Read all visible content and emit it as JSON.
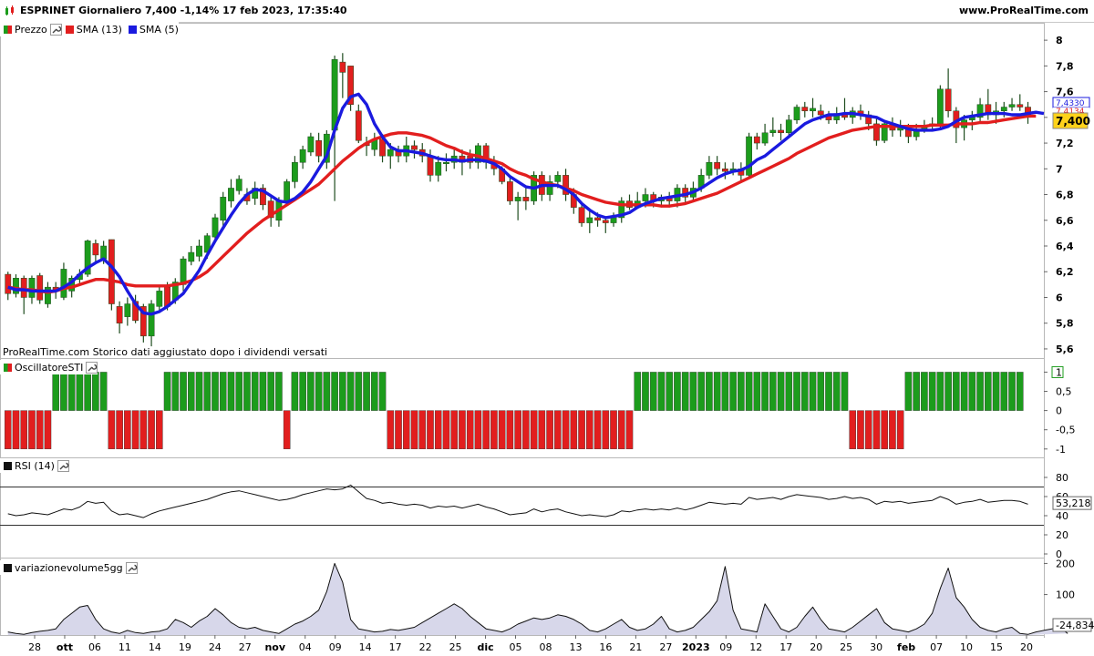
{
  "header": {
    "title": "ESPRINET Giornaliero 7,400 -1,14% 17 feb 2023, 17:35:40",
    "site": "www.ProRealTime.com"
  },
  "legend_price": [
    {
      "label": "Prezzo",
      "color": "split",
      "icon": "candle-icon"
    },
    {
      "label": "SMA (13)",
      "color": "#e21e1e",
      "icon": "line-swatch-icon"
    },
    {
      "label": "SMA (5)",
      "color": "#1a1adf",
      "icon": "line-swatch-icon"
    }
  ],
  "legend_osc": {
    "label": "OscillatoreSTI"
  },
  "legend_rsi": {
    "label": "RSI (14)"
  },
  "legend_vol": {
    "label": "variazionevolume5gg"
  },
  "note": "ProRealTime.com Storico dati aggiustato dopo i dividendi versati",
  "price_axis": {
    "ticks": [
      "8",
      "7,8",
      "7,6",
      "7,4",
      "7,2",
      "7",
      "6,8",
      "6,6",
      "6,4",
      "6,2",
      "6",
      "5,8",
      "5,6"
    ],
    "last_price": "7,400",
    "sma5_tag": "7,4330",
    "sma13_tag": "7,4134"
  },
  "osc_axis": {
    "ticks": [
      "1",
      "0,5",
      "0",
      "-0,5",
      "-1"
    ]
  },
  "rsi_axis": {
    "ticks": [
      "80",
      "60",
      "40",
      "20",
      "0"
    ],
    "value": "53,218"
  },
  "vol_axis": {
    "ticks": [
      "200",
      "100"
    ],
    "value": "-24,834"
  },
  "x_axis": {
    "labels": [
      "28",
      "ott",
      "06",
      "11",
      "14",
      "19",
      "24",
      "27",
      "nov",
      "04",
      "09",
      "14",
      "17",
      "22",
      "25",
      "dic",
      "05",
      "08",
      "13",
      "16",
      "21",
      "27",
      "2023",
      "09",
      "12",
      "17",
      "20",
      "25",
      "30",
      "feb",
      "07",
      "10",
      "15",
      "20"
    ],
    "bold": [
      "ott",
      "nov",
      "dic",
      "2023",
      "feb"
    ]
  },
  "colors": {
    "up": "#1c9c1c",
    "down": "#e21e1e",
    "sma13": "#e21e1e",
    "sma5": "#1a1adf",
    "wick": "#1f4d1f",
    "vol_fill": "#d7d7ea"
  },
  "chart_data": {
    "type": "candlestick",
    "title": "ESPRINET Giornaliero 7,400 -1,14% 17 feb 2023, 17:35:40",
    "ylim": [
      5.55,
      8.1
    ],
    "candles": [
      [
        6.18,
        6.03,
        6.2,
        5.98
      ],
      [
        6.03,
        6.15,
        6.18,
        6.0
      ],
      [
        6.15,
        6.0,
        6.17,
        5.87
      ],
      [
        6.0,
        6.15,
        6.17,
        5.95
      ],
      [
        6.17,
        5.98,
        6.19,
        5.95
      ],
      [
        5.95,
        6.08,
        6.12,
        5.92
      ],
      [
        6.08,
        6.05,
        6.12,
        5.99
      ],
      [
        6.0,
        6.22,
        6.27,
        5.98
      ],
      [
        6.05,
        6.15,
        6.17,
        6.0
      ],
      [
        6.14,
        6.18,
        6.22,
        6.1
      ],
      [
        6.18,
        6.44,
        6.45,
        6.16
      ],
      [
        6.42,
        6.33,
        6.45,
        6.28
      ],
      [
        6.3,
        6.4,
        6.44,
        6.26
      ],
      [
        6.45,
        5.95,
        6.45,
        5.9
      ],
      [
        5.93,
        5.8,
        5.97,
        5.72
      ],
      [
        5.85,
        5.95,
        6.0,
        5.78
      ],
      [
        5.97,
        5.82,
        6.02,
        5.8
      ],
      [
        5.93,
        5.7,
        5.95,
        5.65
      ],
      [
        5.7,
        5.95,
        5.98,
        5.62
      ],
      [
        5.93,
        6.05,
        6.08,
        5.9
      ],
      [
        6.08,
        5.93,
        6.12,
        5.9
      ],
      [
        5.98,
        6.12,
        6.15,
        5.95
      ],
      [
        6.1,
        6.3,
        6.32,
        6.05
      ],
      [
        6.28,
        6.35,
        6.4,
        6.25
      ],
      [
        6.32,
        6.4,
        6.45,
        6.28
      ],
      [
        6.35,
        6.48,
        6.5,
        6.3
      ],
      [
        6.47,
        6.62,
        6.65,
        6.43
      ],
      [
        6.6,
        6.78,
        6.82,
        6.55
      ],
      [
        6.75,
        6.85,
        6.92,
        6.7
      ],
      [
        6.83,
        6.92,
        6.95,
        6.8
      ],
      [
        6.8,
        6.75,
        6.85,
        6.72
      ],
      [
        6.77,
        6.85,
        6.9,
        6.72
      ],
      [
        6.85,
        6.72,
        6.88,
        6.68
      ],
      [
        6.75,
        6.62,
        6.8,
        6.55
      ],
      [
        6.6,
        6.75,
        6.78,
        6.55
      ],
      [
        6.75,
        6.9,
        6.92,
        6.72
      ],
      [
        6.9,
        7.05,
        7.1,
        6.85
      ],
      [
        7.05,
        7.15,
        7.18,
        7.0
      ],
      [
        7.13,
        7.25,
        7.28,
        7.1
      ],
      [
        7.22,
        7.1,
        7.28,
        7.05
      ],
      [
        7.05,
        7.27,
        7.3,
        7.0
      ],
      [
        7.3,
        7.85,
        7.88,
        6.75
      ],
      [
        7.83,
        7.75,
        7.9,
        7.55
      ],
      [
        7.8,
        7.5,
        7.8,
        7.45
      ],
      [
        7.45,
        7.22,
        7.5,
        7.2
      ],
      [
        7.2,
        7.18,
        7.25,
        7.1
      ],
      [
        7.15,
        7.23,
        7.28,
        7.1
      ],
      [
        7.23,
        7.1,
        7.27,
        7.05
      ],
      [
        7.1,
        7.15,
        7.2,
        7.0
      ],
      [
        7.15,
        7.1,
        7.18,
        7.05
      ],
      [
        7.1,
        7.18,
        7.25,
        7.05
      ],
      [
        7.18,
        7.15,
        7.22,
        7.08
      ],
      [
        7.15,
        7.1,
        7.2,
        7.05
      ],
      [
        7.1,
        6.95,
        7.15,
        6.9
      ],
      [
        6.95,
        7.05,
        7.1,
        6.9
      ],
      [
        7.05,
        7.05,
        7.12,
        6.98
      ],
      [
        7.05,
        7.1,
        7.15,
        7.0
      ],
      [
        7.1,
        7.05,
        7.15,
        6.95
      ],
      [
        7.1,
        7.05,
        7.15,
        7.0
      ],
      [
        7.05,
        7.18,
        7.2,
        7.0
      ],
      [
        7.18,
        7.05,
        7.2,
        7.0
      ],
      [
        7.05,
        7.0,
        7.1,
        6.95
      ],
      [
        7.0,
        6.9,
        7.02,
        6.88
      ],
      [
        6.9,
        6.75,
        6.93,
        6.72
      ],
      [
        6.75,
        6.78,
        6.82,
        6.6
      ],
      [
        6.78,
        6.75,
        6.85,
        6.68
      ],
      [
        6.75,
        6.95,
        6.98,
        6.72
      ],
      [
        6.95,
        6.8,
        6.98,
        6.75
      ],
      [
        6.8,
        6.9,
        6.95,
        6.75
      ],
      [
        6.9,
        6.95,
        6.98,
        6.85
      ],
      [
        6.95,
        6.8,
        7.0,
        6.75
      ],
      [
        6.8,
        6.7,
        6.85,
        6.65
      ],
      [
        6.7,
        6.58,
        6.72,
        6.55
      ],
      [
        6.58,
        6.62,
        6.67,
        6.5
      ],
      [
        6.62,
        6.6,
        6.66,
        6.55
      ],
      [
        6.6,
        6.58,
        6.63,
        6.5
      ],
      [
        6.58,
        6.62,
        6.66,
        6.55
      ],
      [
        6.62,
        6.75,
        6.78,
        6.58
      ],
      [
        6.75,
        6.7,
        6.8,
        6.68
      ],
      [
        6.7,
        6.75,
        6.82,
        6.7
      ],
      [
        6.75,
        6.8,
        6.85,
        6.7
      ],
      [
        6.8,
        6.75,
        6.82,
        6.7
      ],
      [
        6.75,
        6.78,
        6.8,
        6.7
      ],
      [
        6.78,
        6.75,
        6.82,
        6.7
      ],
      [
        6.75,
        6.85,
        6.88,
        6.7
      ],
      [
        6.85,
        6.78,
        6.88,
        6.72
      ],
      [
        6.78,
        6.85,
        6.9,
        6.75
      ],
      [
        6.85,
        6.95,
        7.0,
        6.82
      ],
      [
        6.95,
        7.05,
        7.1,
        6.92
      ],
      [
        7.05,
        7.0,
        7.1,
        6.95
      ],
      [
        7.0,
        6.98,
        7.05,
        6.92
      ],
      [
        6.98,
        7.0,
        7.05,
        6.95
      ],
      [
        7.0,
        6.95,
        7.05,
        6.9
      ],
      [
        6.95,
        7.25,
        7.28,
        6.92
      ],
      [
        7.25,
        7.2,
        7.28,
        7.15
      ],
      [
        7.2,
        7.28,
        7.35,
        7.18
      ],
      [
        7.28,
        7.3,
        7.4,
        7.25
      ],
      [
        7.3,
        7.28,
        7.35,
        7.22
      ],
      [
        7.28,
        7.38,
        7.42,
        7.25
      ],
      [
        7.38,
        7.48,
        7.5,
        7.35
      ],
      [
        7.48,
        7.45,
        7.52,
        7.4
      ],
      [
        7.45,
        7.47,
        7.55,
        7.4
      ],
      [
        7.45,
        7.42,
        7.5,
        7.38
      ],
      [
        7.42,
        7.38,
        7.45,
        7.35
      ],
      [
        7.38,
        7.43,
        7.48,
        7.35
      ],
      [
        7.43,
        7.4,
        7.55,
        7.38
      ],
      [
        7.4,
        7.45,
        7.48,
        7.35
      ],
      [
        7.45,
        7.42,
        7.5,
        7.38
      ],
      [
        7.42,
        7.35,
        7.45,
        7.3
      ],
      [
        7.35,
        7.22,
        7.4,
        7.18
      ],
      [
        7.22,
        7.35,
        7.38,
        7.2
      ],
      [
        7.35,
        7.3,
        7.4,
        7.25
      ],
      [
        7.3,
        7.32,
        7.38,
        7.25
      ],
      [
        7.32,
        7.25,
        7.35,
        7.2
      ],
      [
        7.25,
        7.3,
        7.35,
        7.22
      ],
      [
        7.3,
        7.33,
        7.38,
        7.28
      ],
      [
        7.33,
        7.35,
        7.4,
        7.3
      ],
      [
        7.35,
        7.62,
        7.65,
        7.32
      ],
      [
        7.62,
        7.45,
        7.78,
        7.4
      ],
      [
        7.45,
        7.32,
        7.48,
        7.2
      ],
      [
        7.32,
        7.38,
        7.42,
        7.22
      ],
      [
        7.38,
        7.4,
        7.45,
        7.3
      ],
      [
        7.4,
        7.5,
        7.55,
        7.35
      ],
      [
        7.5,
        7.42,
        7.62,
        7.38
      ],
      [
        7.42,
        7.45,
        7.52,
        7.35
      ],
      [
        7.45,
        7.48,
        7.52,
        7.4
      ],
      [
        7.48,
        7.5,
        7.55,
        7.45
      ],
      [
        7.5,
        7.48,
        7.58,
        7.45
      ],
      [
        7.48,
        7.4,
        7.52,
        7.35
      ]
    ],
    "sma13": [
      6.08,
      6.07,
      6.06,
      6.06,
      6.05,
      6.04,
      6.05,
      6.07,
      6.08,
      6.1,
      6.12,
      6.14,
      6.14,
      6.13,
      6.12,
      6.1,
      6.09,
      6.09,
      6.09,
      6.09,
      6.09,
      6.1,
      6.11,
      6.13,
      6.16,
      6.2,
      6.26,
      6.32,
      6.38,
      6.44,
      6.5,
      6.55,
      6.6,
      6.64,
      6.68,
      6.72,
      6.76,
      6.8,
      6.84,
      6.88,
      6.94,
      7.0,
      7.06,
      7.11,
      7.16,
      7.2,
      7.23,
      7.25,
      7.27,
      7.28,
      7.28,
      7.27,
      7.26,
      7.24,
      7.21,
      7.18,
      7.16,
      7.13,
      7.11,
      7.1,
      7.08,
      7.06,
      7.04,
      7.0,
      6.97,
      6.95,
      6.92,
      6.9,
      6.88,
      6.87,
      6.85,
      6.83,
      6.8,
      6.78,
      6.76,
      6.74,
      6.73,
      6.72,
      6.72,
      6.72,
      6.72,
      6.72,
      6.71,
      6.71,
      6.72,
      6.73,
      6.75,
      6.77,
      6.79,
      6.81,
      6.84,
      6.87,
      6.9,
      6.93,
      6.96,
      6.99,
      7.02,
      7.05,
      7.08,
      7.12,
      7.15,
      7.18,
      7.21,
      7.24,
      7.26,
      7.28,
      7.3,
      7.31,
      7.32,
      7.33,
      7.33,
      7.33,
      7.33,
      7.33,
      7.33,
      7.33,
      7.34,
      7.34,
      7.34,
      7.35,
      7.35,
      7.35,
      7.36,
      7.36,
      7.37,
      7.38,
      7.39,
      7.4,
      7.41,
      7.41
    ],
    "sma5": [
      6.08,
      6.06,
      6.06,
      6.05,
      6.05,
      6.05,
      6.05,
      6.08,
      6.12,
      6.18,
      6.23,
      6.27,
      6.3,
      6.24,
      6.16,
      6.05,
      5.95,
      5.88,
      5.87,
      5.89,
      5.93,
      5.98,
      6.03,
      6.12,
      6.21,
      6.33,
      6.44,
      6.54,
      6.64,
      6.73,
      6.8,
      6.84,
      6.83,
      6.79,
      6.75,
      6.74,
      6.77,
      6.82,
      6.9,
      7.0,
      7.1,
      7.3,
      7.47,
      7.56,
      7.58,
      7.5,
      7.35,
      7.25,
      7.17,
      7.14,
      7.14,
      7.13,
      7.12,
      7.1,
      7.08,
      7.07,
      7.07,
      7.06,
      7.07,
      7.07,
      7.06,
      7.04,
      7.0,
      6.94,
      6.9,
      6.86,
      6.85,
      6.87,
      6.87,
      6.87,
      6.84,
      6.8,
      6.73,
      6.68,
      6.64,
      6.62,
      6.63,
      6.64,
      6.66,
      6.7,
      6.73,
      6.75,
      6.77,
      6.78,
      6.79,
      6.8,
      6.82,
      6.85,
      6.89,
      6.93,
      6.96,
      6.98,
      6.99,
      7.02,
      7.07,
      7.1,
      7.15,
      7.2,
      7.25,
      7.3,
      7.35,
      7.38,
      7.4,
      7.42,
      7.42,
      7.43,
      7.43,
      7.42,
      7.41,
      7.4,
      7.37,
      7.35,
      7.33,
      7.31,
      7.3,
      7.3,
      7.3,
      7.31,
      7.33,
      7.37,
      7.4,
      7.41,
      7.42,
      7.43,
      7.43,
      7.43,
      7.42,
      7.42,
      7.43,
      7.44,
      7.43
    ],
    "oscillator": [
      -1,
      -1,
      -1,
      -1,
      -1,
      -1,
      1,
      1,
      1,
      1,
      1,
      1,
      1,
      -1,
      -1,
      -1,
      -1,
      -1,
      -1,
      -1,
      1,
      1,
      1,
      1,
      1,
      1,
      1,
      1,
      1,
      1,
      1,
      1,
      1,
      1,
      1,
      -1,
      1,
      1,
      1,
      1,
      1,
      1,
      1,
      1,
      1,
      1,
      1,
      1,
      -1,
      -1,
      -1,
      -1,
      -1,
      -1,
      -1,
      -1,
      -1,
      -1,
      -1,
      -1,
      -1,
      -1,
      -1,
      -1,
      -1,
      -1,
      -1,
      -1,
      -1,
      -1,
      -1,
      -1,
      -1,
      -1,
      -1,
      -1,
      -1,
      -1,
      -1,
      1,
      1,
      1,
      1,
      1,
      1,
      1,
      1,
      1,
      1,
      1,
      1,
      1,
      1,
      1,
      1,
      1,
      1,
      1,
      1,
      1,
      1,
      1,
      1,
      1,
      1,
      1,
      -1,
      -1,
      -1,
      -1,
      -1,
      -1,
      -1,
      1,
      1,
      1,
      1,
      1,
      1,
      1,
      1,
      1,
      1,
      1,
      1,
      1,
      1,
      1
    ],
    "rsi": [
      42,
      40,
      41,
      43,
      42,
      41,
      44,
      47,
      46,
      49,
      55,
      53,
      54,
      45,
      41,
      42,
      40,
      38,
      42,
      45,
      47,
      49,
      51,
      53,
      55,
      57,
      60,
      63,
      65,
      66,
      64,
      62,
      60,
      58,
      56,
      57,
      59,
      62,
      64,
      66,
      68,
      67,
      68,
      72,
      65,
      58,
      56,
      53,
      54,
      52,
      51,
      52,
      51,
      48,
      50,
      49,
      50,
      48,
      50,
      52,
      49,
      47,
      44,
      41,
      42,
      43,
      47,
      44,
      46,
      47,
      44,
      42,
      40,
      41,
      40,
      39,
      41,
      45,
      44,
      46,
      47,
      46,
      47,
      46,
      48,
      46,
      48,
      51,
      54,
      53,
      52,
      53,
      52,
      59,
      57,
      58,
      59,
      57,
      60,
      62,
      61,
      60,
      59,
      57,
      58,
      60,
      58,
      59,
      57,
      52,
      55,
      54,
      55,
      53,
      54,
      55,
      56,
      60,
      57,
      52,
      54,
      55,
      57,
      54,
      55,
      56,
      56,
      55,
      52
    ],
    "volume": [
      -20,
      -25,
      -28,
      -22,
      -18,
      -15,
      -10,
      20,
      40,
      60,
      65,
      20,
      -10,
      -20,
      -25,
      -15,
      -22,
      -25,
      -20,
      -18,
      -10,
      20,
      10,
      -5,
      15,
      30,
      55,
      35,
      10,
      -5,
      -10,
      -5,
      -15,
      -20,
      -25,
      -10,
      5,
      15,
      30,
      50,
      110,
      200,
      140,
      20,
      -10,
      -15,
      -20,
      -18,
      -12,
      -15,
      -10,
      -5,
      10,
      25,
      40,
      55,
      70,
      55,
      30,
      10,
      -10,
      -15,
      -20,
      -10,
      5,
      15,
      25,
      20,
      25,
      35,
      30,
      20,
      5,
      -15,
      -20,
      -10,
      5,
      20,
      -5,
      -15,
      -10,
      5,
      30,
      -10,
      -20,
      -15,
      -5,
      20,
      45,
      80,
      190,
      50,
      -10,
      -15,
      -20,
      70,
      30,
      -10,
      -20,
      -5,
      30,
      60,
      20,
      -10,
      -15,
      -20,
      -5,
      15,
      35,
      55,
      10,
      -10,
      -15,
      -20,
      -10,
      5,
      40,
      120,
      185,
      90,
      60,
      20,
      -5,
      -15,
      -20,
      -10,
      -5,
      -25,
      -28,
      -20,
      -15,
      -10,
      -5,
      -25
    ]
  }
}
